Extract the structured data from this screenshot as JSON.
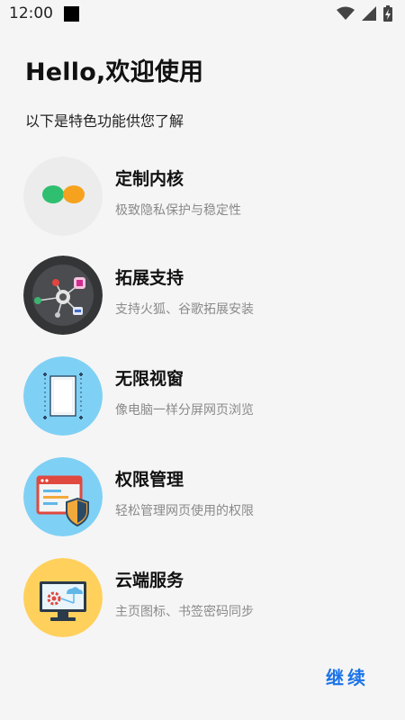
{
  "status_bar": {
    "time": "12:00",
    "icons": [
      "notification-square-icon",
      "wifi-icon",
      "signal-icon",
      "battery-charging-icon"
    ]
  },
  "header": {
    "title": "Hello,欢迎使用",
    "subtitle": "以下是特色功能供您了解"
  },
  "features": [
    {
      "icon": "custom-kernel-icon",
      "title": "定制内核",
      "desc": "极致隐私保护与稳定性"
    },
    {
      "icon": "extension-support-icon",
      "title": "拓展支持",
      "desc": "支持火狐、谷歌拓展安装"
    },
    {
      "icon": "unlimited-window-icon",
      "title": "无限视窗",
      "desc": "像电脑一样分屏网页浏览"
    },
    {
      "icon": "permission-management-icon",
      "title": "权限管理",
      "desc": "轻松管理网页使用的权限"
    },
    {
      "icon": "cloud-service-icon",
      "title": "云端服务",
      "desc": "主页图标、书签密码同步"
    }
  ],
  "actions": {
    "continue_label": "继续"
  },
  "colors": {
    "background": "#f5f5f5",
    "accent": "#1a73e8",
    "desc_text": "#8a8a8a"
  }
}
